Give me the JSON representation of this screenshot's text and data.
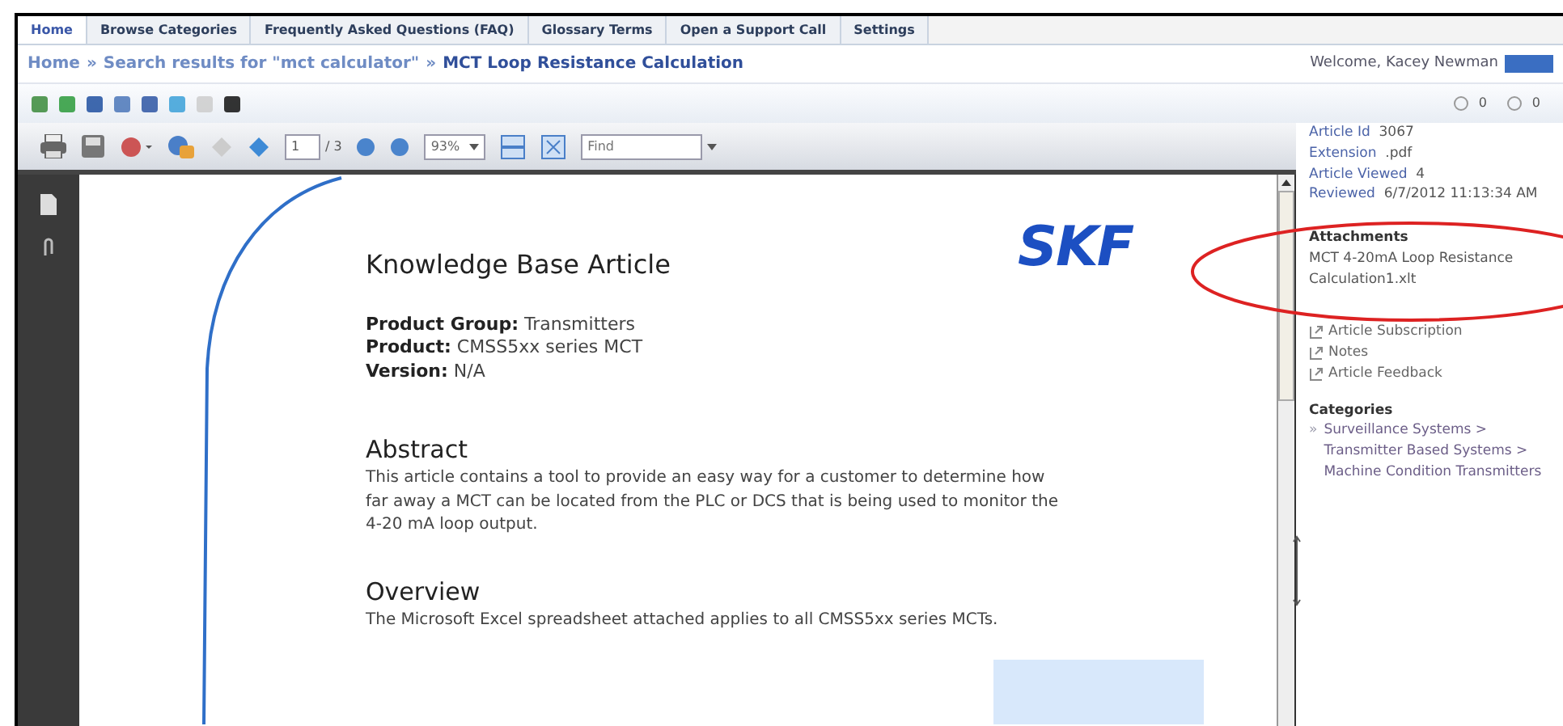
{
  "tabs": [
    {
      "label": "Home",
      "selected": true
    },
    {
      "label": "Browse Categories",
      "selected": false
    },
    {
      "label": "Frequently Asked Questions (FAQ)",
      "selected": false
    },
    {
      "label": "Glossary Terms",
      "selected": false
    },
    {
      "label": "Open a Support Call",
      "selected": false
    },
    {
      "label": "Settings",
      "selected": false
    }
  ],
  "breadcrumb": {
    "separator": "»",
    "items": [
      "Home",
      "Search results for \"mct calculator\"",
      "MCT Loop Resistance Calculation"
    ]
  },
  "welcome": "Welcome, Kacey Newman",
  "rating_counts": [
    "0",
    "0"
  ],
  "viewer_toolbar": {
    "page": "1",
    "page_total": "/ 3",
    "zoom": "93%",
    "find_placeholder": "Find"
  },
  "document": {
    "logo": "SKF",
    "title": "Knowledge Base Article",
    "fields": [
      {
        "label": "Product Group:",
        "value": "Transmitters"
      },
      {
        "label": "Product:",
        "value": "CMSS5xx series MCT"
      },
      {
        "label": "Version:",
        "value": "N/A"
      }
    ],
    "sections": [
      {
        "heading": "Abstract",
        "text": "This article contains a tool to provide an easy way for a customer to determine how far away a MCT can be located from the PLC or DCS that is being used to monitor the 4-20 mA loop output."
      },
      {
        "heading": "Overview",
        "text": "The Microsoft Excel spreadsheet attached applies to all CMSS5xx series MCTs."
      }
    ]
  },
  "article_info": [
    {
      "label": "Article Id",
      "value": "3067"
    },
    {
      "label": "Extension",
      "value": ".pdf"
    },
    {
      "label": "Article Viewed",
      "value": "4"
    },
    {
      "label": "Reviewed",
      "value": "6/7/2012 11:13:34 AM"
    }
  ],
  "attachments": {
    "heading": "Attachments",
    "file": "MCT 4-20mA Loop Resistance Calculation1.xlt"
  },
  "actions": [
    "Article Subscription",
    "Notes",
    "Article Feedback"
  ],
  "categories": {
    "heading": "Categories",
    "bullet": "»",
    "items": [
      "Surveillance Systems > Transmitter Based Systems > Machine Condition Transmitters"
    ]
  }
}
